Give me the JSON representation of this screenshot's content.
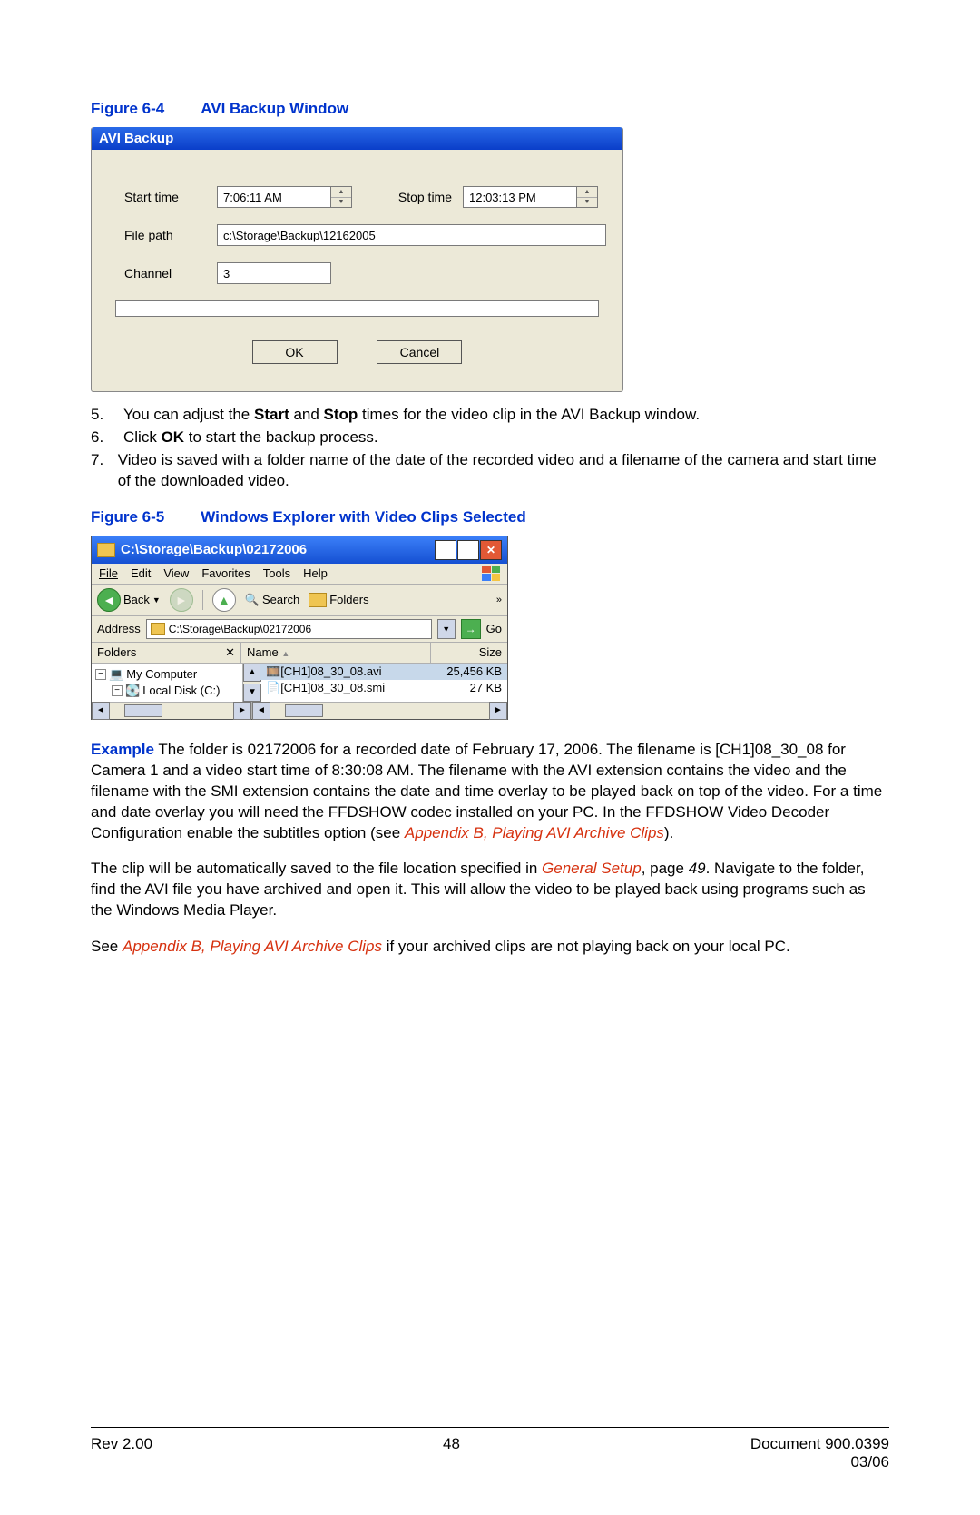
{
  "figure1": {
    "label": "Figure 6-4",
    "title": "AVI Backup Window"
  },
  "avi": {
    "title": "AVI Backup",
    "start_label": "Start time",
    "start_value": "7:06:11 AM",
    "stop_label": "Stop time",
    "stop_value": "12:03:13 PM",
    "path_label": "File path",
    "path_value": "c:\\Storage\\Backup\\12162005",
    "channel_label": "Channel",
    "channel_value": "3",
    "ok": "OK",
    "cancel": "Cancel"
  },
  "steps": {
    "n5": "5.",
    "t5a": "You can adjust the ",
    "t5b": "Start",
    "t5c": " and ",
    "t5d": "Stop",
    "t5e": " times for the video clip in the AVI Backup window.",
    "n6": "6.",
    "t6a": "Click ",
    "t6b": "OK",
    "t6c": " to start the backup process.",
    "n7": "7.",
    "t7": "Video is saved with a folder name of the date of the recorded video and a filename of the camera and start time of the downloaded video."
  },
  "figure2": {
    "label": "Figure 6-5",
    "title": "Windows Explorer with Video Clips Selected"
  },
  "explorer": {
    "title": "C:\\Storage\\Backup\\02172006",
    "menus": [
      "File",
      "Edit",
      "View",
      "Favorites",
      "Tools",
      "Help"
    ],
    "back": "Back",
    "search": "Search",
    "folders": "Folders",
    "address_label": "Address",
    "address_value": "C:\\Storage\\Backup\\02172006",
    "go": "Go",
    "col_folders": "Folders",
    "col_name": "Name",
    "col_size": "Size",
    "tree_mycomputer": "My Computer",
    "tree_localdisk": "Local Disk (C:)",
    "file1_name": "[CH1]08_30_08.avi",
    "file1_size": "25,456 KB",
    "file2_name": "[CH1]08_30_08.smi",
    "file2_size": "27 KB"
  },
  "para1": {
    "example": "Example",
    "text1": "  The folder is 02172006 for a recorded date of February 17, 2006. The filename is [CH1]08_30_08 for Camera 1 and a video start time of 8:30:08 AM. The filename with the AVI extension contains the video and the filename with the SMI extension contains the date and time overlay to be played back on top of the video. For a time and date overlay you will need the FFDSHOW codec installed on your PC. In the FFDSHOW Video Decoder Configuration enable the subtitles option (see ",
    "link1": "Appendix B, Playing AVI Archive Clips",
    "text2": ")."
  },
  "para2": {
    "text1": "The clip will be automatically saved to the file location specified in ",
    "link1": "General Setup",
    "text2": ", page ",
    "page": "49",
    "text3": ". Navigate to the folder, find the AVI file you have archived and open it. This will allow the video to be played back using programs such as the Windows Media Player."
  },
  "para3": {
    "text1": "See ",
    "link1": "Appendix B, Playing AVI Archive Clips",
    "text2": " if your archived clips are not playing back on your local PC."
  },
  "footer": {
    "rev": "Rev 2.00",
    "page": "48",
    "doc1": "Document 900.0399",
    "doc2": "03/06"
  }
}
